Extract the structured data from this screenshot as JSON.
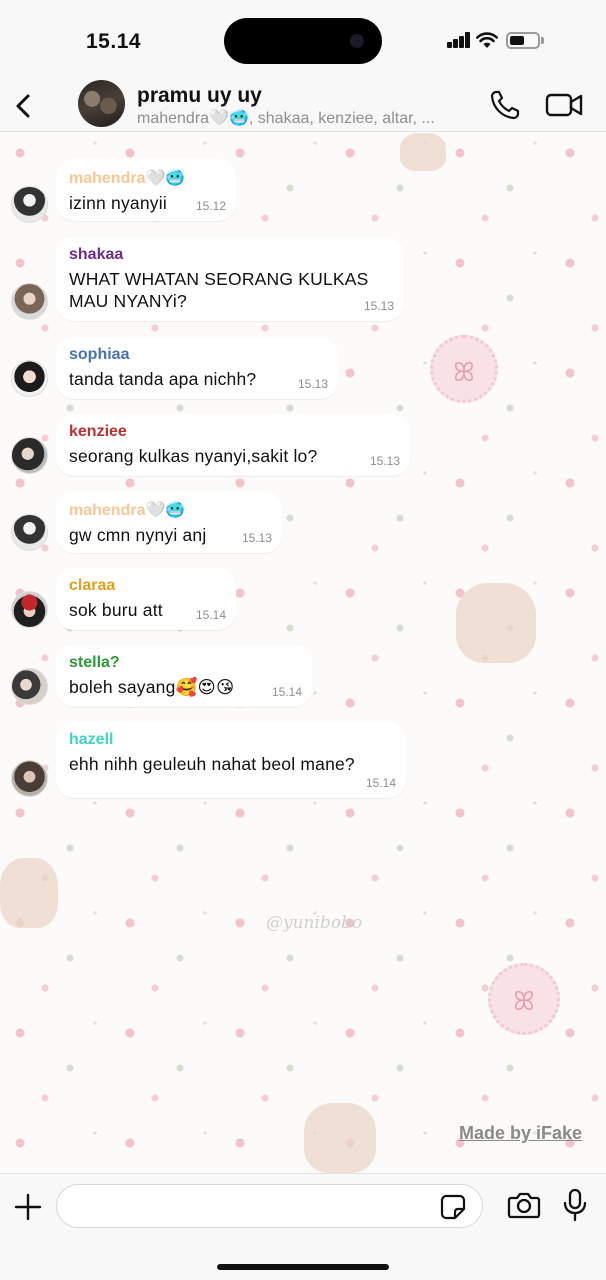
{
  "status_bar": {
    "time": "15.14"
  },
  "header": {
    "group_name": "pramu uy uy",
    "members": "mahendra🤍🥶, shakaa, kenziee, altar, ..."
  },
  "colors": {
    "mahendra": "#f6c896",
    "shakaa": "#6a2e8c",
    "sophiaa": "#4a72b0",
    "kenziee": "#b83232",
    "claraa": "#e0a21a",
    "stella": "#2e9a3a",
    "hazell": "#3fd4c3"
  },
  "messages": [
    {
      "sender": "mahendra🤍🥶",
      "text": "izinn nyanyii",
      "time": "15.12"
    },
    {
      "sender": "shakaa",
      "text": "WHAT WHATAN SEORANG KULKAS MAU NYANYi?",
      "time": "15.13"
    },
    {
      "sender": "sophiaa",
      "text": "tanda tanda apa nichh?",
      "time": "15.13"
    },
    {
      "sender": "kenziee",
      "text": "seorang kulkas nyanyi,sakit lo?",
      "time": "15.13"
    },
    {
      "sender": "mahendra🤍🥶",
      "text": "gw cmn nynyi anj",
      "time": "15.13"
    },
    {
      "sender": "claraa",
      "text": "sok buru att",
      "time": "15.14"
    },
    {
      "sender": "stella?",
      "text": "boleh sayang🥰😍😘",
      "time": "15.14"
    },
    {
      "sender": "hazell",
      "text": "ehh nihh geuleuh nahat beol mane?",
      "time": "15.14"
    }
  ],
  "watermarks": {
    "background": "@yunibobo",
    "app": "Made by iFake"
  },
  "composer": {
    "placeholder": ""
  },
  "icons": [
    "back-icon",
    "phone-icon",
    "video-camera-icon",
    "plus-icon",
    "sticker-icon",
    "camera-icon",
    "microphone-icon"
  ]
}
